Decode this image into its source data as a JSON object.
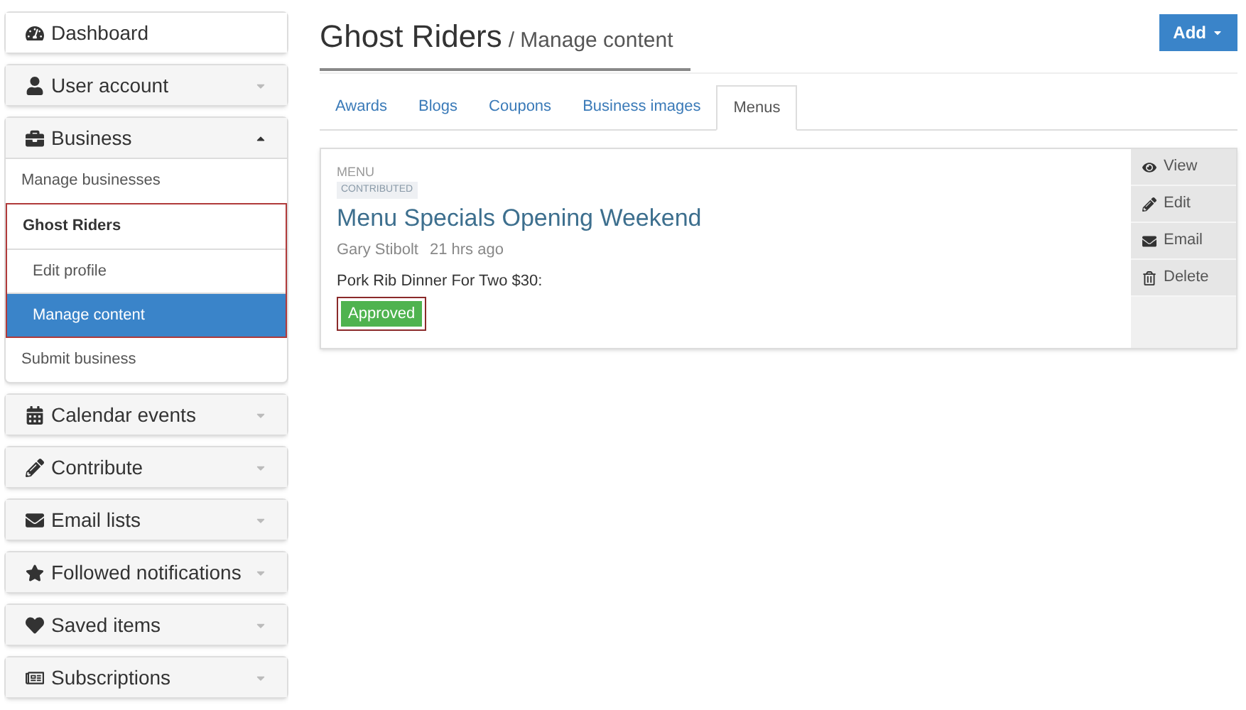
{
  "sidebar": {
    "panels": [
      {
        "label": "Dashboard",
        "kind": "link"
      },
      {
        "label": "User account",
        "kind": "collapsible",
        "expanded": false
      },
      {
        "label": "Business",
        "kind": "collapsible",
        "expanded": true,
        "items": [
          {
            "label": "Manage businesses",
            "kind": "link"
          },
          {
            "label": "Ghost Riders",
            "kind": "group",
            "highlighted": true,
            "children": [
              {
                "label": "Edit profile",
                "selected": false
              },
              {
                "label": "Manage content",
                "selected": true
              }
            ]
          },
          {
            "label": "Submit business",
            "kind": "link"
          }
        ]
      },
      {
        "label": "Calendar events",
        "kind": "collapsible",
        "expanded": false
      },
      {
        "label": "Contribute",
        "kind": "collapsible",
        "expanded": false
      },
      {
        "label": "Email lists",
        "kind": "collapsible",
        "expanded": false
      },
      {
        "label": "Followed notifications",
        "kind": "collapsible",
        "expanded": false
      },
      {
        "label": "Saved items",
        "kind": "collapsible",
        "expanded": false
      },
      {
        "label": "Subscriptions",
        "kind": "collapsible",
        "expanded": false
      }
    ]
  },
  "header": {
    "title": "Ghost Riders",
    "subtitle": "/ Manage content",
    "add_button": "Add"
  },
  "tabs": [
    {
      "label": "Awards",
      "selected": false
    },
    {
      "label": "Blogs",
      "selected": false
    },
    {
      "label": "Coupons",
      "selected": false
    },
    {
      "label": "Business images",
      "selected": false
    },
    {
      "label": "Menus",
      "selected": true
    }
  ],
  "card": {
    "type_label": "MENU",
    "tag": "CONTRIBUTED",
    "title": "Menu Specials Opening Weekend",
    "author": "Gary Stibolt",
    "time": "21 hrs ago",
    "body": "Pork Rib Dinner For Two $30:",
    "status": {
      "label": "Approved",
      "highlighted": true
    },
    "actions": [
      "View",
      "Edit",
      "Email",
      "Delete"
    ]
  }
}
